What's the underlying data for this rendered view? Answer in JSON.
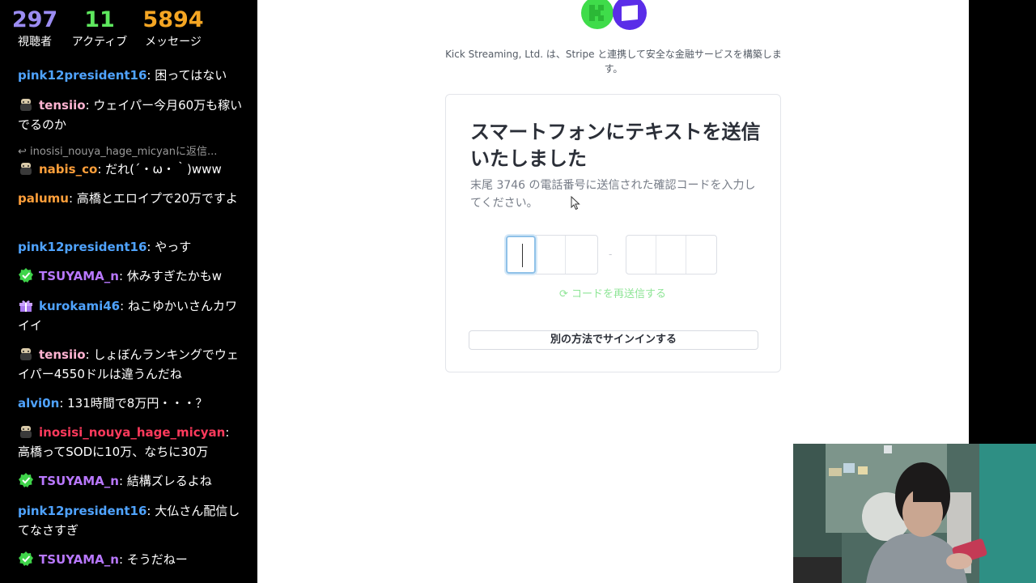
{
  "stats": {
    "viewers": {
      "value": "297",
      "label": "視聴者",
      "color": "#9b8cf2"
    },
    "active": {
      "value": "11",
      "label": "アクティブ",
      "color": "#5ee85e"
    },
    "messages": {
      "value": "5894",
      "label": "メッセージ",
      "color": "#f5a623"
    }
  },
  "chat": [
    {
      "user": "pink12president16",
      "color": "#4fa3ff",
      "badge": "none",
      "text": "困ってはない"
    },
    {
      "user": "tensiio",
      "color": "#ffb3d1",
      "badge": "avatar-icon",
      "text": "ウェイパー今月60万も稼いでるのか"
    },
    {
      "reply_to": "inosisi_nouya_hage_micyanに返信..."
    },
    {
      "user": "nabis_co",
      "color": "#ff9f3a",
      "badge": "avatar-icon",
      "text": "だれ(´・ω・｀)www"
    },
    {
      "user": "palumu",
      "color": "#ff9f3a",
      "badge": "none",
      "text": "高橋とエロイプで20万ですよ"
    },
    {
      "user": "pink12president16",
      "color": "#4fa3ff",
      "badge": "none",
      "text": "やっす"
    },
    {
      "user": "TSUYAMA_n",
      "color": "#b978ff",
      "badge": "verified-icon",
      "text": "休みすぎたかもw"
    },
    {
      "user": "kurokami46",
      "color": "#4fa3ff",
      "badge": "gift-icon",
      "text": "ねこゆかいさんカワイイ"
    },
    {
      "user": "tensiio",
      "color": "#ffb3d1",
      "badge": "avatar-icon",
      "text": "しょぼんランキングでウェイパー4550ドルは違うんだね"
    },
    {
      "user": "alvi0n",
      "color": "#4fa3ff",
      "badge": "none",
      "text": "131時間で8万円・・・？"
    },
    {
      "user": "inosisi_nouya_hage_micyan",
      "color": "#ff3a5c",
      "badge": "avatar-icon",
      "text": "高橋ってSODに10万、なちに30万"
    },
    {
      "user": "TSUYAMA_n",
      "color": "#b978ff",
      "badge": "verified-icon",
      "text": "結構ズレるよね"
    },
    {
      "user": "pink12president16",
      "color": "#4fa3ff",
      "badge": "none",
      "text": "大仏さん配信してなさすぎ"
    },
    {
      "user": "TSUYAMA_n",
      "color": "#b978ff",
      "badge": "verified-icon",
      "text": "そうだねー"
    }
  ],
  "page": {
    "partner_text": "Kick Streaming, Ltd. は、Stripe と連携して安全な金融サービスを構築します。",
    "title": "スマートフォンにテキストを送信いたしました",
    "description": "末尾 3746 の電話番号に送信された確認コードを入力してください。",
    "code_separator": "-",
    "resend_label": "コードを再送信する",
    "alt_signin_label": "別の方法でサインインする",
    "colors": {
      "logo_green": "#3fdc4a",
      "logo_purple": "#5a2de8",
      "resend": "#8fe597",
      "focus": "#8fc1e8"
    }
  }
}
